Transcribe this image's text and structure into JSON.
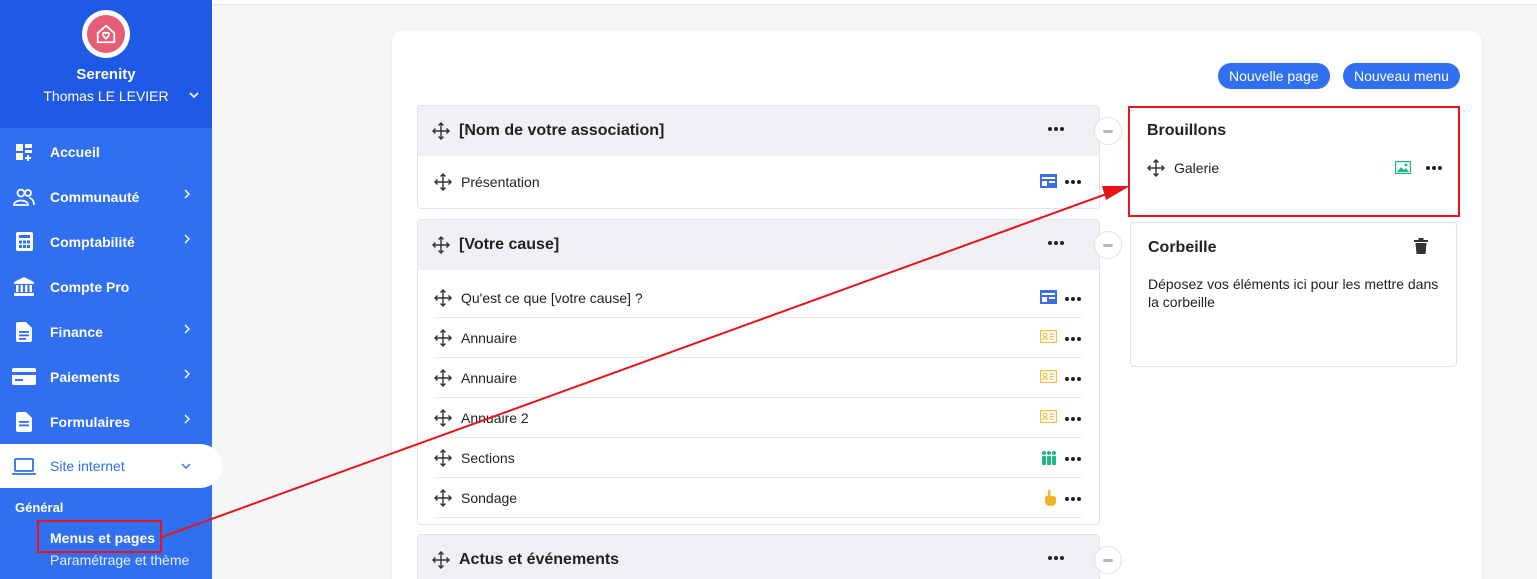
{
  "sidebar": {
    "org_name": "Serenity",
    "user_name": "Thomas LE LEVIER",
    "items": [
      {
        "label": "Accueil",
        "icon": "dashboard-icon",
        "has_chevron": false
      },
      {
        "label": "Communauté",
        "icon": "users-icon",
        "has_chevron": true
      },
      {
        "label": "Comptabilité",
        "icon": "calculator-icon",
        "has_chevron": true
      },
      {
        "label": "Compte Pro",
        "icon": "bank-icon",
        "has_chevron": false
      },
      {
        "label": "Finance",
        "icon": "document-icon",
        "has_chevron": true
      },
      {
        "label": "Paiements",
        "icon": "credit-card-icon",
        "has_chevron": true
      },
      {
        "label": "Formulaires",
        "icon": "form-icon",
        "has_chevron": true
      },
      {
        "label": "Site internet",
        "icon": "laptop-icon",
        "has_chevron": true,
        "active": true
      }
    ],
    "section_label": "Général",
    "sub_items": [
      {
        "label": "Menus et pages",
        "current": true
      },
      {
        "label": "Paramétrage et thème",
        "current": false
      }
    ]
  },
  "toolbar": {
    "new_page_label": "Nouvelle page",
    "new_menu_label": "Nouveau menu"
  },
  "menus": [
    {
      "title": "[Nom de votre association]",
      "pages": [
        {
          "label": "Présentation",
          "type_icon": "layout-icon"
        }
      ]
    },
    {
      "title": "[Votre cause]",
      "pages": [
        {
          "label": "Qu'est ce que [votre cause] ?",
          "type_icon": "layout-icon"
        },
        {
          "label": "Annuaire",
          "type_icon": "contact-card-icon"
        },
        {
          "label": "Annuaire",
          "type_icon": "contact-card-icon"
        },
        {
          "label": "Annuaire 2",
          "type_icon": "contact-card-icon"
        },
        {
          "label": "Sections",
          "type_icon": "group-icon"
        },
        {
          "label": "Sondage",
          "type_icon": "hand-pointer-icon"
        }
      ]
    },
    {
      "title": "Actus et événements",
      "pages": []
    }
  ],
  "drafts": {
    "title": "Brouillons",
    "items": [
      {
        "label": "Galerie",
        "type_icon": "image-icon"
      }
    ]
  },
  "trash": {
    "title": "Corbeille",
    "description": "Déposez vos éléments ici pour les mettre dans la corbeille"
  },
  "colors": {
    "sidebar_bg": "#2f6ff0",
    "accent": "#2f6ff0",
    "highlight": "#e8141c",
    "logo": "#e85d75"
  }
}
